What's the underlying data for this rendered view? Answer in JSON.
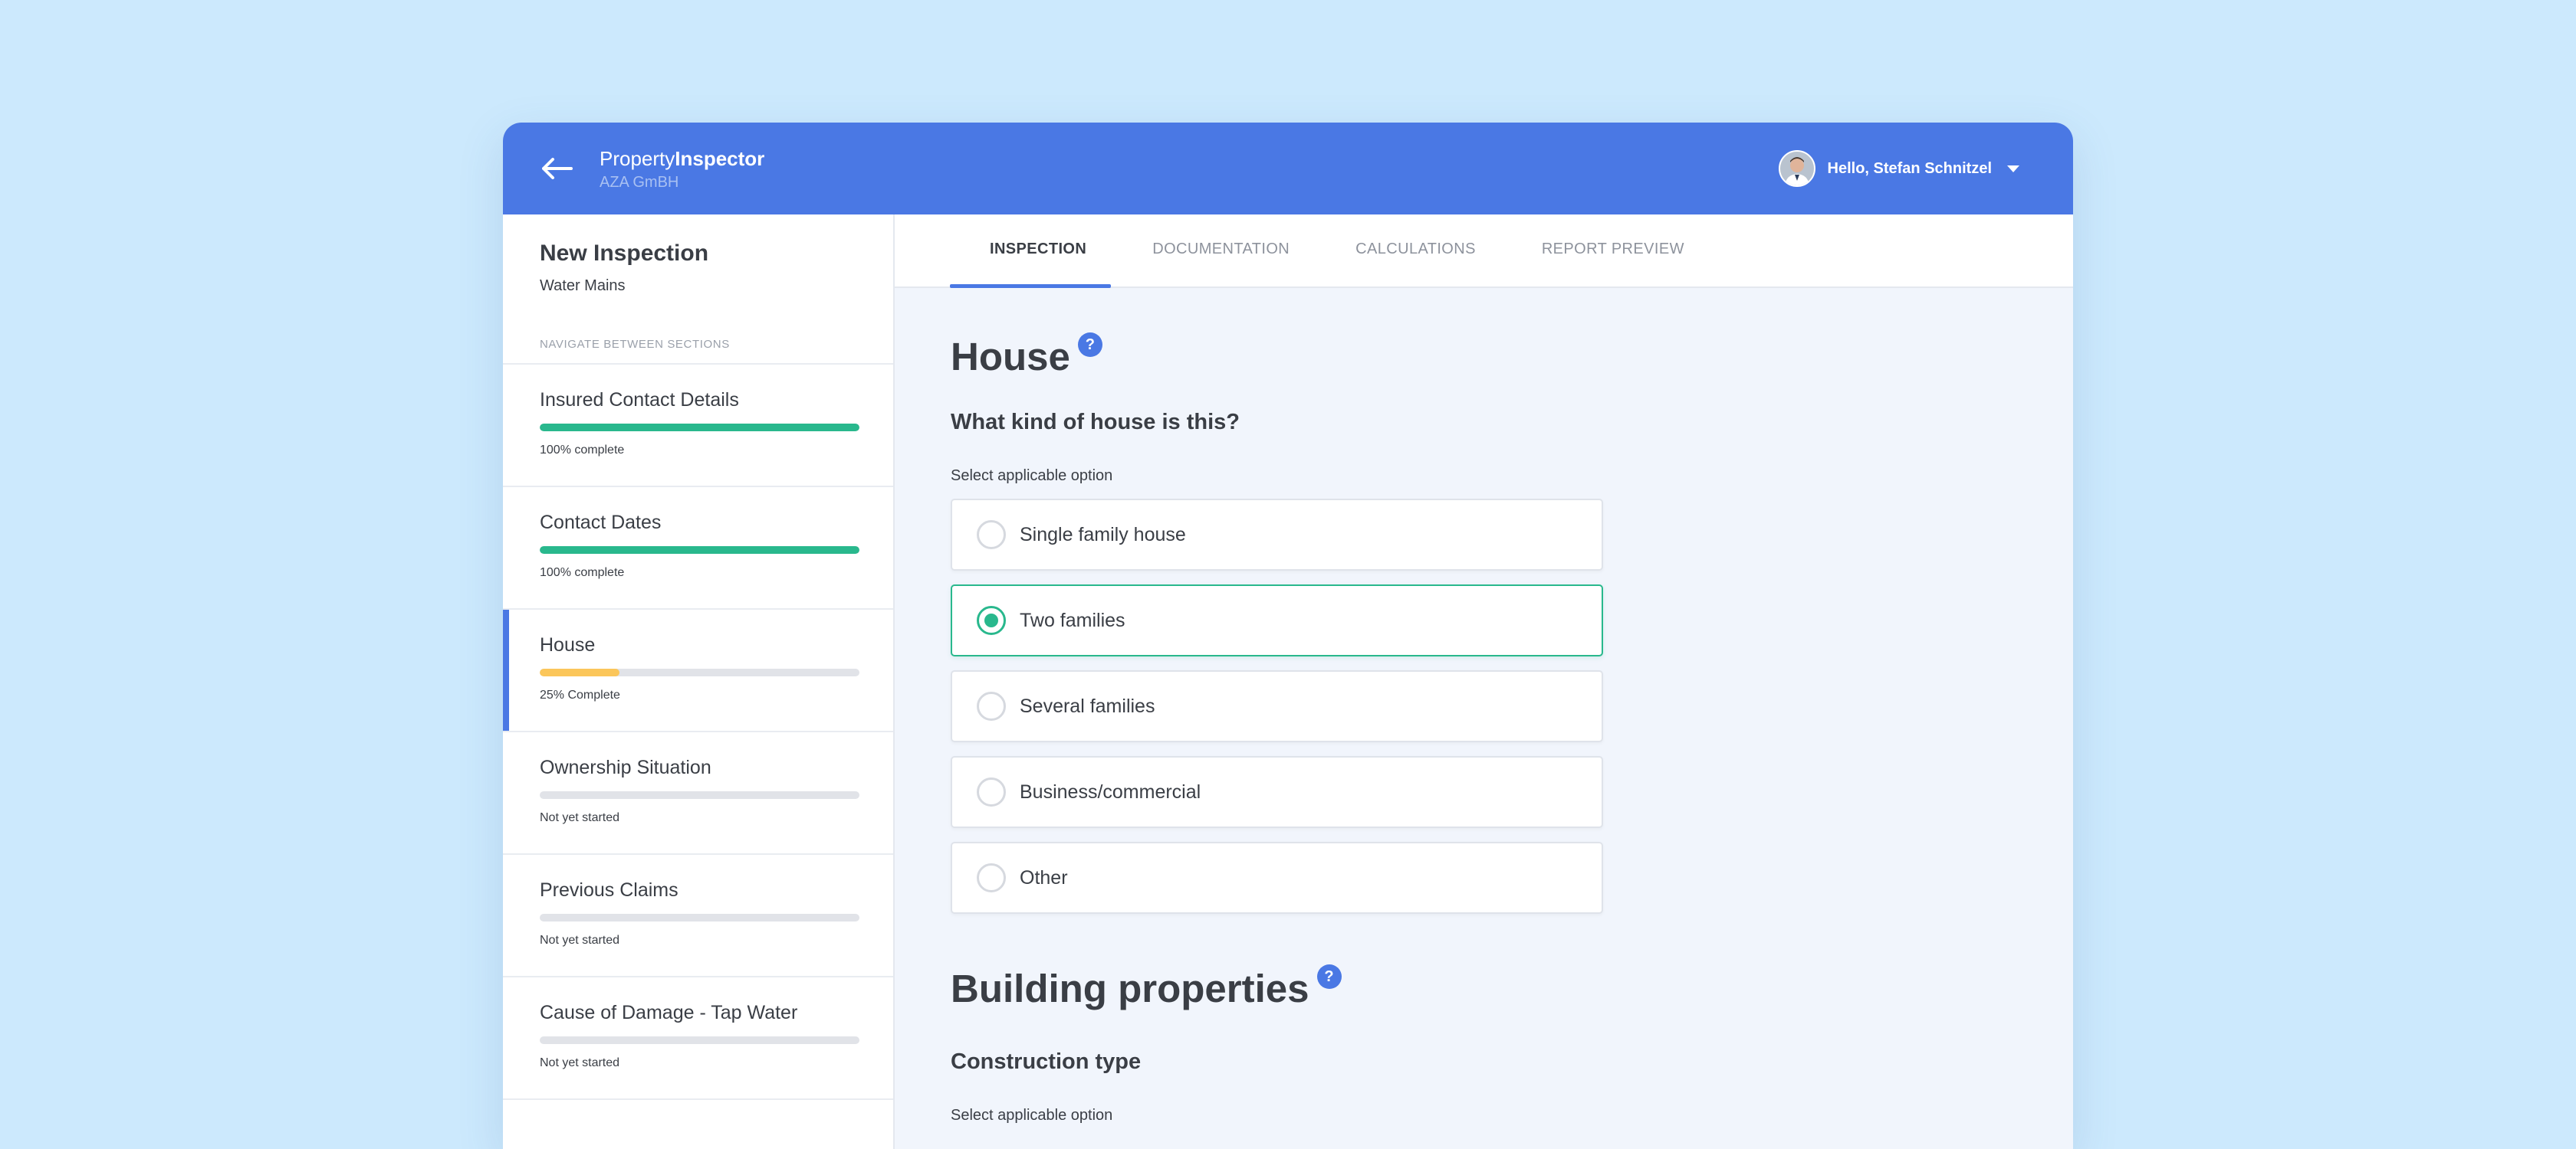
{
  "header": {
    "brand_light": "Property",
    "brand_bold": "Inspector",
    "company": "AZA GmBH",
    "greeting": "Hello, Stefan Schnitzel",
    "accent": "#4a78e4"
  },
  "sidebar": {
    "title": "New Inspection",
    "subtitle": "Water Mains",
    "nav_label": "NAVIGATE BETWEEN SECTIONS",
    "sections": [
      {
        "label": "Insured Contact Details",
        "status": "100% complete",
        "progress": 1.0,
        "color": "#29b88d"
      },
      {
        "label": "Contact Dates",
        "status": "100% complete",
        "progress": 1.0,
        "color": "#29b88d"
      },
      {
        "label": "House",
        "status": "25% Complete",
        "progress": 0.25,
        "color": "#fbc65a"
      },
      {
        "label": "Ownership Situation",
        "status": "Not yet started",
        "progress": 0,
        "color": "#e1e3e8"
      },
      {
        "label": "Previous Claims",
        "status": "Not yet started",
        "progress": 0,
        "color": "#e1e3e8"
      },
      {
        "label": "Cause of Damage - Tap Water",
        "status": "Not yet started",
        "progress": 0,
        "color": "#e1e3e8"
      }
    ]
  },
  "tabs": [
    "INSPECTION",
    "DOCUMENTATION",
    "CALCULATIONS",
    "REPORT PREVIEW"
  ],
  "main": {
    "section_title": "House",
    "help_glyph": "?",
    "question": "What kind of house is this?",
    "hint": "Select applicable option",
    "options": [
      "Single family house",
      "Two families",
      "Several families",
      "Business/commercial",
      "Other"
    ],
    "selected_option": "Two families",
    "section2_title": "Building properties",
    "question2": "Construction type",
    "hint2": "Select applicable option"
  }
}
